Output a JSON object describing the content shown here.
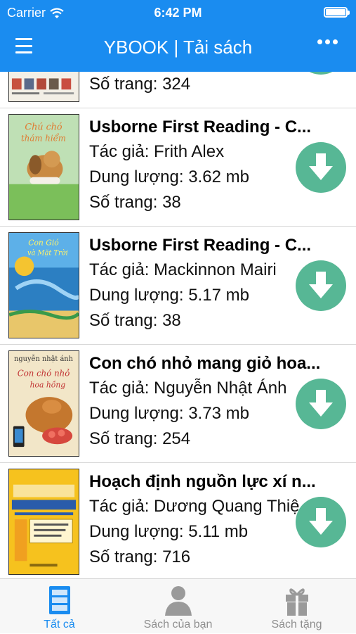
{
  "status_bar": {
    "carrier": "Carrier",
    "time": "6:42 PM",
    "battery_level": 1.0
  },
  "nav": {
    "title": "YBOOK | Tải sách"
  },
  "books": [
    {
      "title": "",
      "author": "",
      "size": "",
      "pages": "Số trang: 324"
    },
    {
      "title": "Usborne First Reading - C...",
      "author": "Tác giả: Frith Alex",
      "size": "Dung lượng: 3.62 mb",
      "pages": "Số trang: 38"
    },
    {
      "title": "Usborne First Reading - C...",
      "author": "Tác giả: Mackinnon Mairi",
      "size": "Dung lượng: 5.17 mb",
      "pages": "Số trang: 38"
    },
    {
      "title": "Con chó nhỏ mang giỏ hoa...",
      "author": "Tác giả: Nguyễn Nhật Ánh",
      "size": "Dung lượng: 3.73 mb",
      "pages": "Số trang: 254"
    },
    {
      "title": "Hoạch định nguồn lực xí n...",
      "author": "Tác giả: Dương Quang Thiện",
      "size": "Dung lượng: 5.11 mb",
      "pages": "Số trang: 716"
    }
  ],
  "tabs": [
    {
      "label": "Tất cả",
      "icon": "book-list-icon",
      "active": true
    },
    {
      "label": "Sách của bạn",
      "icon": "user-icon",
      "active": false
    },
    {
      "label": "Sách tặng",
      "icon": "gift-icon",
      "active": false
    }
  ],
  "colors": {
    "nav_bg": "#1a8cf0",
    "download_button": "#57b795",
    "tab_active": "#1a8cf0",
    "tab_inactive": "#8e8e8e"
  }
}
